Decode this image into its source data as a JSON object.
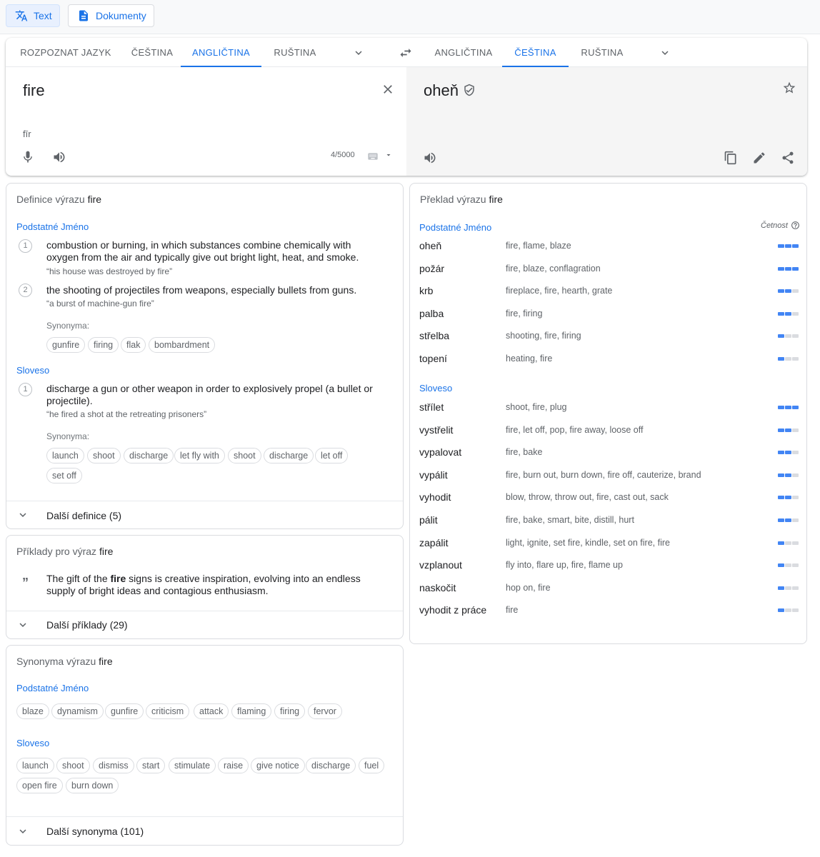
{
  "modes": {
    "text": "Text",
    "docs": "Dokumenty"
  },
  "source_langs": [
    "ROZPOZNAT JAZYK",
    "ČEŠTINA",
    "ANGLIČTINA",
    "RUŠTINA"
  ],
  "target_langs": [
    "ANGLIČTINA",
    "ČEŠTINA",
    "RUŠTINA"
  ],
  "source": {
    "text": "fire",
    "transliteration": "fīr",
    "counter": "4/5000"
  },
  "target": {
    "text": "oheň"
  },
  "definitions": {
    "title_prefix": "Definice výrazu ",
    "word": "fire",
    "noun_label": "Podstatné Jméno",
    "verb_label": "Sloveso",
    "synonyms_label": "Synonyma:",
    "noun_defs": [
      {
        "num": "1",
        "text": "combustion or burning, in which substances combine chemically with oxygen from the air and typically give out bright light, heat, and smoke.",
        "example": "“his house was destroyed by fire”"
      },
      {
        "num": "2",
        "text": "the shooting of projectiles from weapons, especially bullets from guns.",
        "example": "“a burst of machine-gun fire”"
      }
    ],
    "noun_synonyms": [
      "gunfire",
      "firing",
      "flak",
      "bombardment"
    ],
    "verb_defs": [
      {
        "num": "1",
        "text": "discharge a gun or other weapon in order to explosively propel (a bullet or projectile).",
        "example": "“he fired a shot at the retreating prisoners”"
      }
    ],
    "verb_synonyms": [
      "launch",
      "shoot",
      "discharge",
      "let fly with",
      "shoot",
      "discharge",
      "let off",
      "set off"
    ],
    "more": "Další definice (5)"
  },
  "examples": {
    "title_prefix": "Příklady pro výraz ",
    "word": "fire",
    "quote_before": "The gift of the ",
    "quote_bold": "fire",
    "quote_after": " signs is creative inspiration, evolving into an endless supply of bright ideas and contagious enthusiasm.",
    "more": "Další příklady (29)"
  },
  "synonyms": {
    "title_prefix": "Synonyma výrazu ",
    "word": "fire",
    "noun_label": "Podstatné Jméno",
    "verb_label": "Sloveso",
    "noun": [
      "blaze",
      "dynamism",
      "gunfire",
      "criticism",
      "attack",
      "flaming",
      "firing",
      "fervor"
    ],
    "verb": [
      "launch",
      "shoot",
      "dismiss",
      "start",
      "stimulate",
      "raise",
      "give notice",
      "discharge",
      "fuel",
      "open fire",
      "burn down"
    ],
    "more": "Další synonyma (101)"
  },
  "translations": {
    "title_prefix": "Překlad výrazu ",
    "word": "fire",
    "frequency_label": "Četnost",
    "noun_label": "Podstatné Jméno",
    "verb_label": "Sloveso",
    "noun": [
      {
        "word": "oheň",
        "back": "fire, flame, blaze",
        "freq": 3
      },
      {
        "word": "požár",
        "back": "fire, blaze, conflagration",
        "freq": 3
      },
      {
        "word": "krb",
        "back": "fireplace, fire, hearth, grate",
        "freq": 2
      },
      {
        "word": "palba",
        "back": "fire, firing",
        "freq": 2
      },
      {
        "word": "střelba",
        "back": "shooting, fire, firing",
        "freq": 1
      },
      {
        "word": "topení",
        "back": "heating, fire",
        "freq": 1
      }
    ],
    "verb": [
      {
        "word": "střílet",
        "back": "shoot, fire, plug",
        "freq": 3
      },
      {
        "word": "vystřelit",
        "back": "fire, let off, pop, fire away, loose off",
        "freq": 2
      },
      {
        "word": "vypalovat",
        "back": "fire, bake",
        "freq": 2
      },
      {
        "word": "vypálit",
        "back": "fire, burn out, burn down, fire off, cauterize, brand",
        "freq": 2
      },
      {
        "word": "vyhodit",
        "back": "blow, throw, throw out, fire, cast out, sack",
        "freq": 2
      },
      {
        "word": "pálit",
        "back": "fire, bake, smart, bite, distill, hurt",
        "freq": 2
      },
      {
        "word": "zapálit",
        "back": "light, ignite, set fire, kindle, set on fire, fire",
        "freq": 1
      },
      {
        "word": "vzplanout",
        "back": "fly into, flare up, fire, flame up",
        "freq": 1
      },
      {
        "word": "naskočit",
        "back": "hop on, fire",
        "freq": 1
      },
      {
        "word": "vyhodit z práce",
        "back": "fire",
        "freq": 1
      }
    ]
  }
}
